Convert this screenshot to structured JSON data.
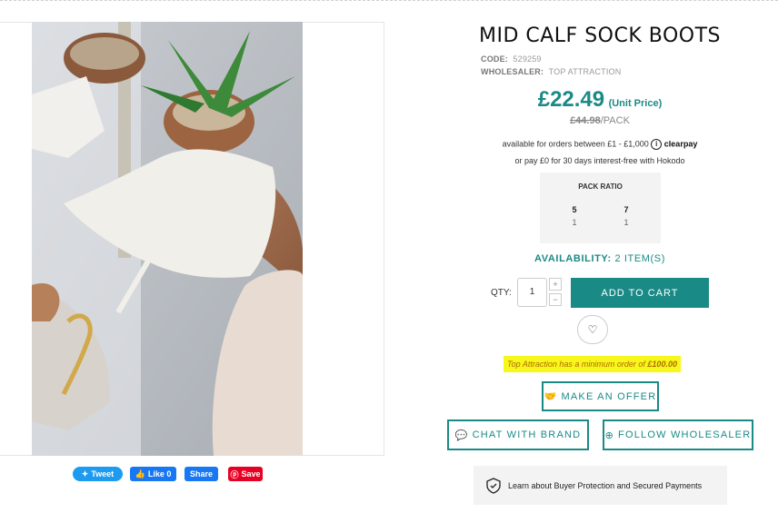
{
  "product": {
    "title": "MID CALF SOCK BOOTS",
    "code_label": "CODE:",
    "code_value": "529259",
    "wholesaler_label": "WHOLESALER:",
    "wholesaler_value": "TOP ATTRACTION",
    "price": "£22.49",
    "price_unit": "(Unit Price)",
    "pack_price": "£44.98",
    "pack_suffix": "/PACK",
    "clearpay_text": "available for orders between £1 - £1,000",
    "clearpay_brand": "clearpay",
    "hokodo_text": "or pay £0 for 30 days interest-free with Hokodo"
  },
  "pack_ratio": {
    "title": "PACK RATIO",
    "sizes": [
      "5",
      "7"
    ],
    "quantities": [
      "1",
      "1"
    ]
  },
  "availability": {
    "label": "AVAILABILITY:",
    "value": "2 ITEM(S)"
  },
  "cart": {
    "qty_label": "QTY:",
    "qty_value": "1",
    "plus": "+",
    "minus": "−",
    "add_label": "ADD TO CART"
  },
  "min_order": {
    "text": "Top Attraction has a minimum order of",
    "amount": "£100.00"
  },
  "buttons": {
    "offer": "MAKE AN OFFER",
    "chat": "CHAT WITH BRAND",
    "follow": "FOLLOW WHOLESALER"
  },
  "protection": {
    "text": "Learn about Buyer Protection and Secured Payments"
  },
  "social": {
    "tweet": "Tweet",
    "like": "Like 0",
    "share": "Share",
    "save": "Save"
  },
  "colors": {
    "accent": "#1a8a86",
    "highlight": "#f7f71c"
  }
}
